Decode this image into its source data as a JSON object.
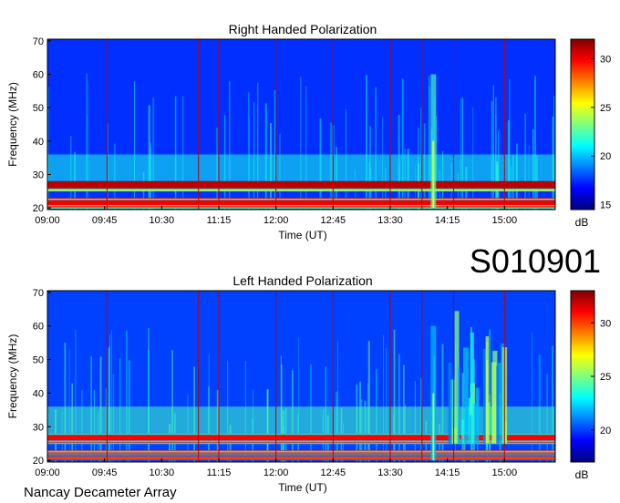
{
  "id_label": "S010901",
  "footer": "Nancay Decameter Array",
  "colormap": [
    "#00007f",
    "#0000ff",
    "#007fff",
    "#00ffff",
    "#7fff7f",
    "#ffff00",
    "#ff7f00",
    "#ff0000",
    "#7f0000"
  ],
  "chart_data": [
    {
      "type": "heatmap",
      "title": "Right Handed Polarization",
      "xlabel": "Time (UT)",
      "ylabel": "Frequency (MHz)",
      "x_ticks": [
        "09:00",
        "09:45",
        "10:30",
        "11:15",
        "12:00",
        "12:45",
        "13:30",
        "14:15",
        "15:00"
      ],
      "y_ticks": [
        20,
        30,
        40,
        50,
        60,
        70
      ],
      "ylim": [
        19.5,
        70.5
      ],
      "colorbar": {
        "label": "dB",
        "ticks": [
          15,
          20,
          25,
          30
        ],
        "range": [
          14.5,
          32
        ]
      },
      "vertical_lines_ut": [
        "09:47",
        "10:59",
        "11:15",
        "12:00",
        "12:45",
        "13:30",
        "13:55",
        "14:20",
        "15:00"
      ],
      "features": [
        {
          "kind": "band",
          "freq_range": [
            25,
            28
          ],
          "level_db": 31
        },
        {
          "kind": "band",
          "freq_range": [
            20,
            23
          ],
          "level_db": 30
        },
        {
          "kind": "burst",
          "time_ut": "14:04",
          "freq_range": [
            20,
            70
          ],
          "level_db": 25
        }
      ]
    },
    {
      "type": "heatmap",
      "title": "Left Handed Polarization",
      "xlabel": "Time (UT)",
      "ylabel": "Frequency (MHz)",
      "x_ticks": [
        "09:00",
        "09:45",
        "10:30",
        "11:15",
        "12:00",
        "12:45",
        "13:30",
        "14:15",
        "15:00"
      ],
      "y_ticks": [
        20,
        30,
        40,
        50,
        60,
        70
      ],
      "ylim": [
        19.5,
        70.5
      ],
      "colorbar": {
        "label": "dB",
        "ticks": [
          20,
          25,
          30
        ],
        "range": [
          17,
          33
        ]
      },
      "vertical_lines_ut": [
        "09:47",
        "10:59",
        "11:15",
        "12:00",
        "12:45",
        "13:30",
        "13:55",
        "14:20",
        "15:00"
      ],
      "features": [
        {
          "kind": "band",
          "freq_range": [
            25,
            28
          ],
          "level_db": 31
        },
        {
          "kind": "band",
          "freq_range": [
            20,
            23
          ],
          "level_db": 30
        },
        {
          "kind": "burst",
          "time_ut": "14:04",
          "freq_range": [
            20,
            70
          ],
          "level_db": 25
        },
        {
          "kind": "storm",
          "time_range_ut": [
            "14:15",
            "15:00"
          ],
          "freq_range": [
            25,
            68
          ],
          "level_db": 27
        }
      ]
    }
  ]
}
